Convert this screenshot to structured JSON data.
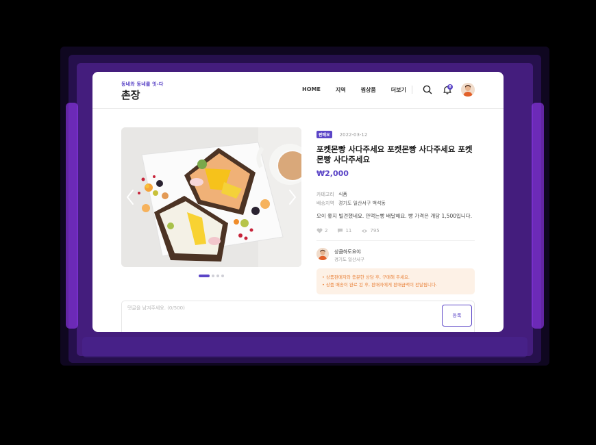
{
  "brand": {
    "sub": "동네와 동네를 잇-다",
    "title": "촌장"
  },
  "nav": [
    "HOME",
    "지역",
    "찜상품",
    "더보기"
  ],
  "notification_count": "8",
  "product": {
    "tag": "판매요",
    "date": "2022-03-12",
    "title": "포켓몬빵 사다주세요 포켓몬빵 사다주세요 포켓몬빵 사다주세요",
    "price": "₩2,000",
    "category_label": "카테고리",
    "category_value": "식품",
    "area_label": "배송지역",
    "area_value": "경기도 일산서구 백석동",
    "description": "오이 좋지 빌견했네요. 안먹는빵 배달해요. 빵 가격은 개당 1,500입니다.",
    "likes": "2",
    "comments": "11",
    "views": "795"
  },
  "seller": {
    "name": "상큼하도요야",
    "location": "경기도 일산서구"
  },
  "notice": [
    "• 상품판매자와 충분한 상담 후, 구매해 주세요.",
    "• 상품 배송이 완료 된 후, 판매자에게 판매금액이 전달됩니다."
  ],
  "comment": {
    "placeholder": "댓글을 남겨주세요. (0/500)",
    "submit_label": "등록"
  },
  "colors": {
    "accent": "#5b45c7",
    "notice_bg": "#fdf1e6",
    "notice_text": "#e9823a"
  },
  "carousel": {
    "slide_count": 4,
    "active_index": 0
  }
}
